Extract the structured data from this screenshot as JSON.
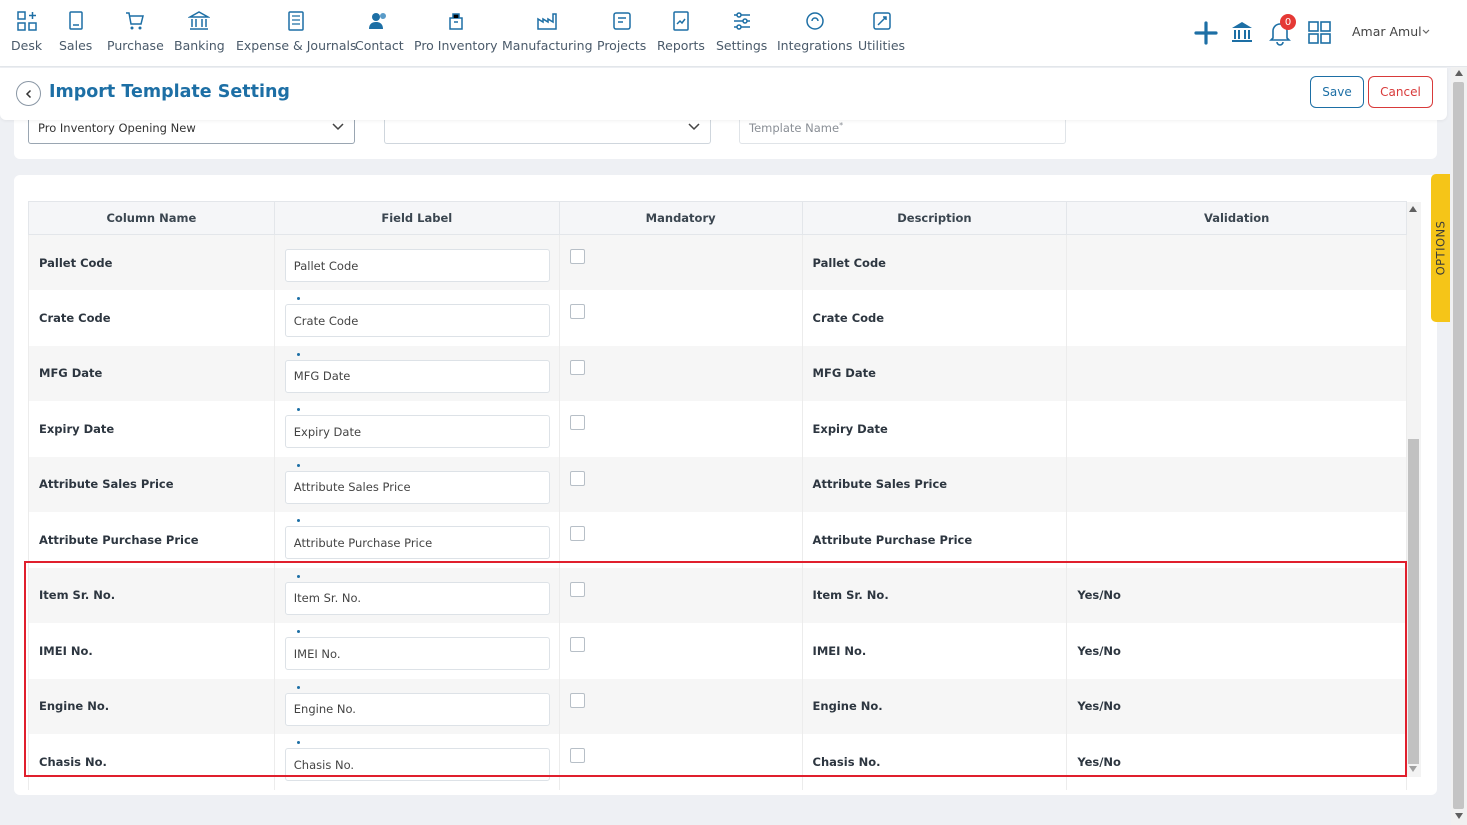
{
  "nav": {
    "items": [
      {
        "label": "Desk",
        "icon": "desk-icon"
      },
      {
        "label": "Sales",
        "icon": "sales-icon"
      },
      {
        "label": "Purchase",
        "icon": "cart-icon"
      },
      {
        "label": "Banking",
        "icon": "bank-icon"
      },
      {
        "label": "Expense & Journals",
        "icon": "journal-icon"
      },
      {
        "label": "Contact",
        "icon": "contact-icon"
      },
      {
        "label": "Pro Inventory",
        "icon": "inventory-icon"
      },
      {
        "label": "Manufacturing",
        "icon": "factory-icon"
      },
      {
        "label": "Projects",
        "icon": "projects-icon"
      },
      {
        "label": "Reports",
        "icon": "reports-icon"
      },
      {
        "label": "Settings",
        "icon": "settings-icon"
      },
      {
        "label": "Integrations",
        "icon": "integrations-icon"
      },
      {
        "label": "Utilities",
        "icon": "utilities-icon"
      }
    ],
    "notification_count": "0",
    "user_name": "Amar Amul"
  },
  "header": {
    "title": "Import Template Setting",
    "save_label": "Save",
    "cancel_label": "Cancel"
  },
  "filters": {
    "template_type": "Pro Inventory Opening New",
    "second_select": "",
    "template_name_placeholder": "Template Name",
    "template_name_required": "*"
  },
  "table": {
    "headers": {
      "column_name": "Column Name",
      "field_label": "Field Label",
      "mandatory": "Mandatory",
      "description": "Description",
      "validation": "Validation"
    },
    "rows": [
      {
        "column_name": "Pallet Code",
        "field_label": "Pallet Code",
        "mandatory": false,
        "description": "Pallet Code",
        "validation": ""
      },
      {
        "column_name": "Crate Code",
        "field_label": "Crate Code",
        "mandatory": false,
        "description": "Crate Code",
        "validation": ""
      },
      {
        "column_name": "MFG Date",
        "field_label": "MFG Date",
        "mandatory": false,
        "description": "MFG Date",
        "validation": ""
      },
      {
        "column_name": "Expiry Date",
        "field_label": "Expiry Date",
        "mandatory": false,
        "description": "Expiry Date",
        "validation": ""
      },
      {
        "column_name": "Attribute Sales Price",
        "field_label": "Attribute Sales Price",
        "mandatory": false,
        "description": "Attribute Sales Price",
        "validation": ""
      },
      {
        "column_name": "Attribute Purchase Price",
        "field_label": "Attribute Purchase Price",
        "mandatory": false,
        "description": "Attribute Purchase Price",
        "validation": ""
      },
      {
        "column_name": "Item Sr. No.",
        "field_label": "Item Sr. No.",
        "mandatory": false,
        "description": "Item Sr. No.",
        "validation": "Yes/No"
      },
      {
        "column_name": "IMEI No.",
        "field_label": "IMEI No.",
        "mandatory": false,
        "description": "IMEI No.",
        "validation": "Yes/No"
      },
      {
        "column_name": "Engine No.",
        "field_label": "Engine No.",
        "mandatory": false,
        "description": "Engine No.",
        "validation": "Yes/No"
      },
      {
        "column_name": "Chasis No.",
        "field_label": "Chasis No.",
        "mandatory": false,
        "description": "Chasis No.",
        "validation": "Yes/No"
      }
    ]
  },
  "options_tab_label": "OPTIONS",
  "colors": {
    "brand": "#1d6fa5",
    "cancel": "#d83a3a",
    "highlight": "#e01f2d",
    "options_tab": "#f5c518"
  }
}
